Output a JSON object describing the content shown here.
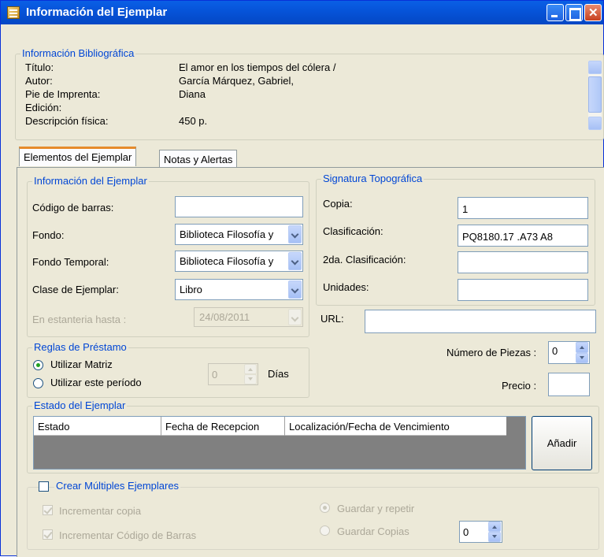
{
  "window": {
    "title": "Información del Ejemplar"
  },
  "biblio": {
    "legend": "Información Bibliográfica",
    "rows": [
      {
        "label": "Título:",
        "value": "El amor en los tiempos del cólera /"
      },
      {
        "label": "Autor:",
        "value": "García Márquez, Gabriel,"
      },
      {
        "label": "Pie de Imprenta:",
        "value": "Diana"
      },
      {
        "label": "Edición:",
        "value": ""
      },
      {
        "label": "Descripción física:",
        "value": "450 p."
      }
    ]
  },
  "tabs": [
    {
      "label": "Elementos del Ejemplar",
      "active": true
    },
    {
      "label": "Notas y Alertas",
      "active": false
    }
  ],
  "info_ejemplar": {
    "legend": "Información del Ejemplar",
    "codigo_label": "Código de barras:",
    "codigo_value": "",
    "fondo_label": "Fondo:",
    "fondo_value": "Biblioteca Filosofía y",
    "fondo_temp_label": "Fondo Temporal:",
    "fondo_temp_value": "Biblioteca Filosofía y",
    "clase_label": "Clase de Ejemplar:",
    "clase_value": "Libro",
    "estanteria_label": "En estanteria hasta :",
    "estanteria_value": "24/08/2011"
  },
  "signatura": {
    "legend": "Signatura Topográfica",
    "copia_label": "Copia:",
    "copia_value": "1",
    "clasif_label": "Clasificación:",
    "clasif_value": "PQ8180.17 .A73 A8",
    "clasif2_label": "2da. Clasificación:",
    "clasif2_value": "",
    "unidades_label": "Unidades:",
    "unidades_value": ""
  },
  "url": {
    "label": "URL:",
    "value": ""
  },
  "reglas": {
    "legend": "Reglas de Préstamo",
    "opt1": "Utilizar Matriz",
    "opt2": "Utilizar este período",
    "dias_value": "0",
    "dias_label": "Días"
  },
  "piezas": {
    "label": "Número de Piezas :",
    "value": "0"
  },
  "precio": {
    "label": "Precio :",
    "value": ""
  },
  "estado": {
    "legend": "Estado del Ejemplar",
    "columns": [
      "Estado",
      "Fecha de Recepcion",
      "Localización/Fecha de Vencimiento"
    ],
    "add_button": "Añadir"
  },
  "multiples": {
    "legend": "Crear Múltiples Ejemplares",
    "inc_copia": "Incrementar copia",
    "inc_codigo": "Incrementar Código de Barras",
    "guardar_repetir": "Guardar y repetir",
    "guardar_copias": "Guardar Copias",
    "copias_value": "0"
  },
  "colors": {
    "title_bar": "#0653d8",
    "legend_text": "#0046d5",
    "tab_highlight": "#e68b2c",
    "grid_bg": "#808080"
  }
}
